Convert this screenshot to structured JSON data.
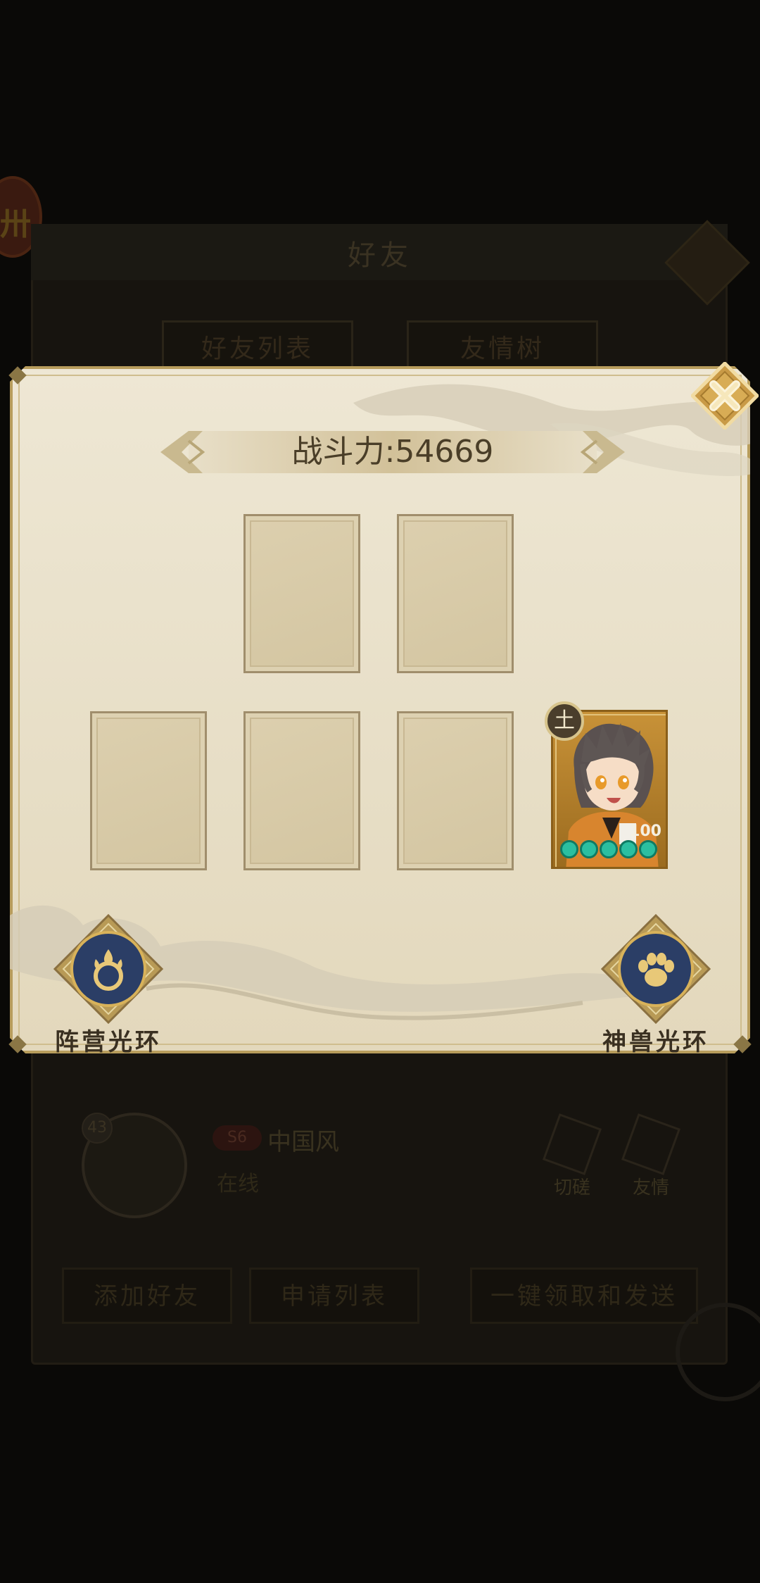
{
  "background": {
    "title": "好友",
    "emblem_glyph": "卅",
    "tabs": [
      "好友列表",
      "友情树"
    ],
    "friend": {
      "level": "43",
      "vip": "S6",
      "name": "中国风",
      "status": "在线",
      "actions": [
        "切磋",
        "友情"
      ]
    },
    "buttons": [
      "添加好友",
      "申请列表",
      "一键领取和发送"
    ]
  },
  "popup": {
    "power_label": "战斗力:54669",
    "hero": {
      "element": "土",
      "level": "100",
      "stars": 5
    },
    "camp_aura_label": "阵营光环",
    "beast_aura_label": "神兽光环"
  },
  "colors": {
    "panel_bg": "#eee7d4",
    "panel_border": "#b89d5c",
    "aura_blue": "#2b3e66",
    "aura_gold": "#d8b25a",
    "star_green": "#2bbfa0"
  }
}
